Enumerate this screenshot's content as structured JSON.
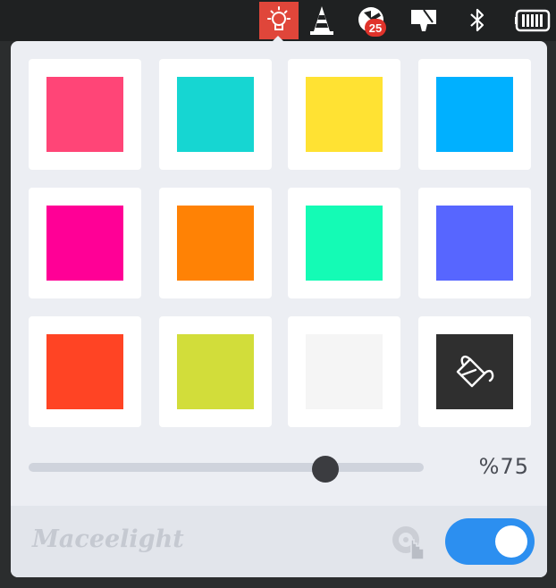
{
  "tray": {
    "icons": [
      "lightbulb-icon",
      "vlc-cone-icon",
      "clock-icon",
      "projector-icon",
      "bluetooth-icon",
      "battery-icon"
    ],
    "badge_count": "25"
  },
  "colors": {
    "tray_active": "#e0463a",
    "accent": "#2c8ff0"
  },
  "swatches": [
    {
      "color": "#ff4577"
    },
    {
      "color": "#16d6d2"
    },
    {
      "color": "#ffe233"
    },
    {
      "color": "#00b0ff"
    },
    {
      "color": "#ff0096"
    },
    {
      "color": "#ff8205"
    },
    {
      "color": "#14fbb5"
    },
    {
      "color": "#5766ff"
    },
    {
      "color": "#ff4424"
    },
    {
      "color": "#d2dd3a"
    },
    {
      "color": "#f5f5f5"
    },
    {
      "color": "#2f2f2f",
      "icon": "paint-bucket-icon"
    }
  ],
  "brightness": {
    "value": 75,
    "label": "%75"
  },
  "footer": {
    "brand": "Maceelight",
    "toggle_on": true
  }
}
